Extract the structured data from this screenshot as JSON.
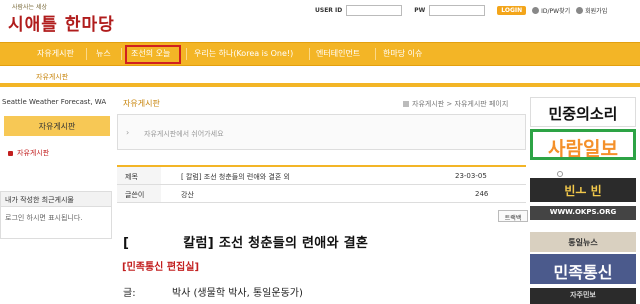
{
  "header": {
    "logo_slogan": "사람사는 세상",
    "logo_name": "시애틀 한마당"
  },
  "login": {
    "user_id_label": "USER ID",
    "pw_label": "PW",
    "login_button": "LOGIN",
    "find_link": "ID/PW찾기",
    "join_link": "회원가입"
  },
  "nav": {
    "items": [
      "자유게시판",
      "뉴스",
      "조선의 오늘",
      "우리는 하나(Korea is One!)",
      "엔터테인먼트",
      "한마당 이슈"
    ],
    "highlight_color": "#d02020",
    "bar_color": "#f3b526"
  },
  "subnav": {
    "label": "자유게시판"
  },
  "sidebar": {
    "weather": "Seattle Weather Forecast, WA",
    "title": "자유게시판",
    "item": "자유게시판",
    "recent_title": "내가 작성한 최근게시물",
    "recent_empty": "로그인 하시면 표시됩니다."
  },
  "board": {
    "title": "자유게시판",
    "breadcrumb": "자유게시판 > 자유게시판 페이지",
    "description": "자유게시판에서 쉬어가세요",
    "subject_label": "제목",
    "subject_value": "[ 칼럼] 조선 청춘들의 련애와 결혼 외",
    "date": "23-03-05",
    "author_label": "글쓴이",
    "author_value": "강산",
    "views": "246",
    "trackback": "트랙백"
  },
  "article": {
    "title_open": "[",
    "title_rest": "칼럼] 조선 청춘들의 련애와 결혼",
    "subtitle": "[민족통신 편집실]",
    "body_label": "글:",
    "body_value": "박사 (생물학 박사, 통일운동가)"
  },
  "ads": {
    "ad1": "민중의소리",
    "ad2": "사람일보",
    "ad3": "빈ㅗ   빈",
    "ad4": "WWW.OKPS.ORG",
    "ad5": "통일뉴스",
    "ad6": "민족통신",
    "ad7": "자주민보"
  }
}
